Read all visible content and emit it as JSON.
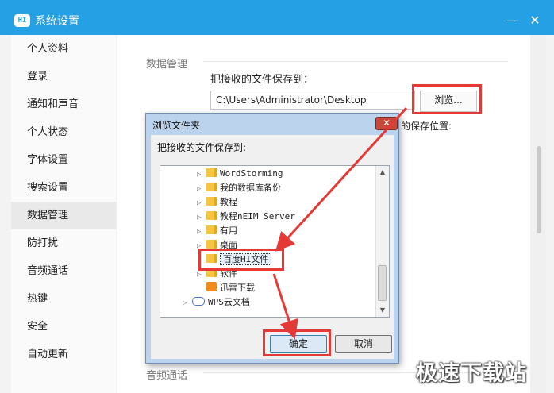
{
  "window": {
    "title": "系统设置",
    "logo_text": "HI",
    "minimize": "—",
    "close": "✕"
  },
  "sidebar": {
    "items": [
      {
        "label": "个人资料"
      },
      {
        "label": "登录"
      },
      {
        "label": "通知和声音"
      },
      {
        "label": "个人状态"
      },
      {
        "label": "字体设置"
      },
      {
        "label": "搜索设置"
      },
      {
        "label": "数据管理",
        "active": true
      },
      {
        "label": "防打扰"
      },
      {
        "label": "音频通话"
      },
      {
        "label": "热键"
      },
      {
        "label": "安全"
      },
      {
        "label": "自动更新"
      }
    ]
  },
  "main": {
    "section_title": "数据管理",
    "save_label": "把接收的文件保存到：",
    "path_value": "C:\\Users\\Administrator\\Desktop",
    "browse_label": "浏览...",
    "partial_text": "的保存位置:",
    "bottom_section_title": "音频通话"
  },
  "dialog": {
    "title": "浏览文件夹",
    "close": "✕",
    "prompt": "把接收的文件保存到:",
    "tree": [
      {
        "label": "WordStorming",
        "icon": "folder-icon"
      },
      {
        "label": "我的数据库备份",
        "icon": "folder-icon"
      },
      {
        "label": "教程",
        "icon": "folder-icon"
      },
      {
        "label": "教程nEIM Server",
        "icon": "folder-icon"
      },
      {
        "label": "有用",
        "icon": "folder-icon"
      },
      {
        "label": "桌面",
        "icon": "folder-icon"
      },
      {
        "label": "百度HI文件",
        "icon": "folder-icon",
        "selected": true
      },
      {
        "label": "软件",
        "icon": "folder-icon"
      },
      {
        "label": "迅雷下载",
        "icon": "thunder-icon"
      },
      {
        "label": "WPS云文档",
        "icon": "cloud-icon"
      }
    ],
    "ok_label": "确定",
    "cancel_label": "取消"
  },
  "watermark": "极速下载站",
  "colors": {
    "titlebar": "#25a0e4",
    "highlight": "#e53935",
    "selected_sidebar": "#e9e9e9"
  }
}
